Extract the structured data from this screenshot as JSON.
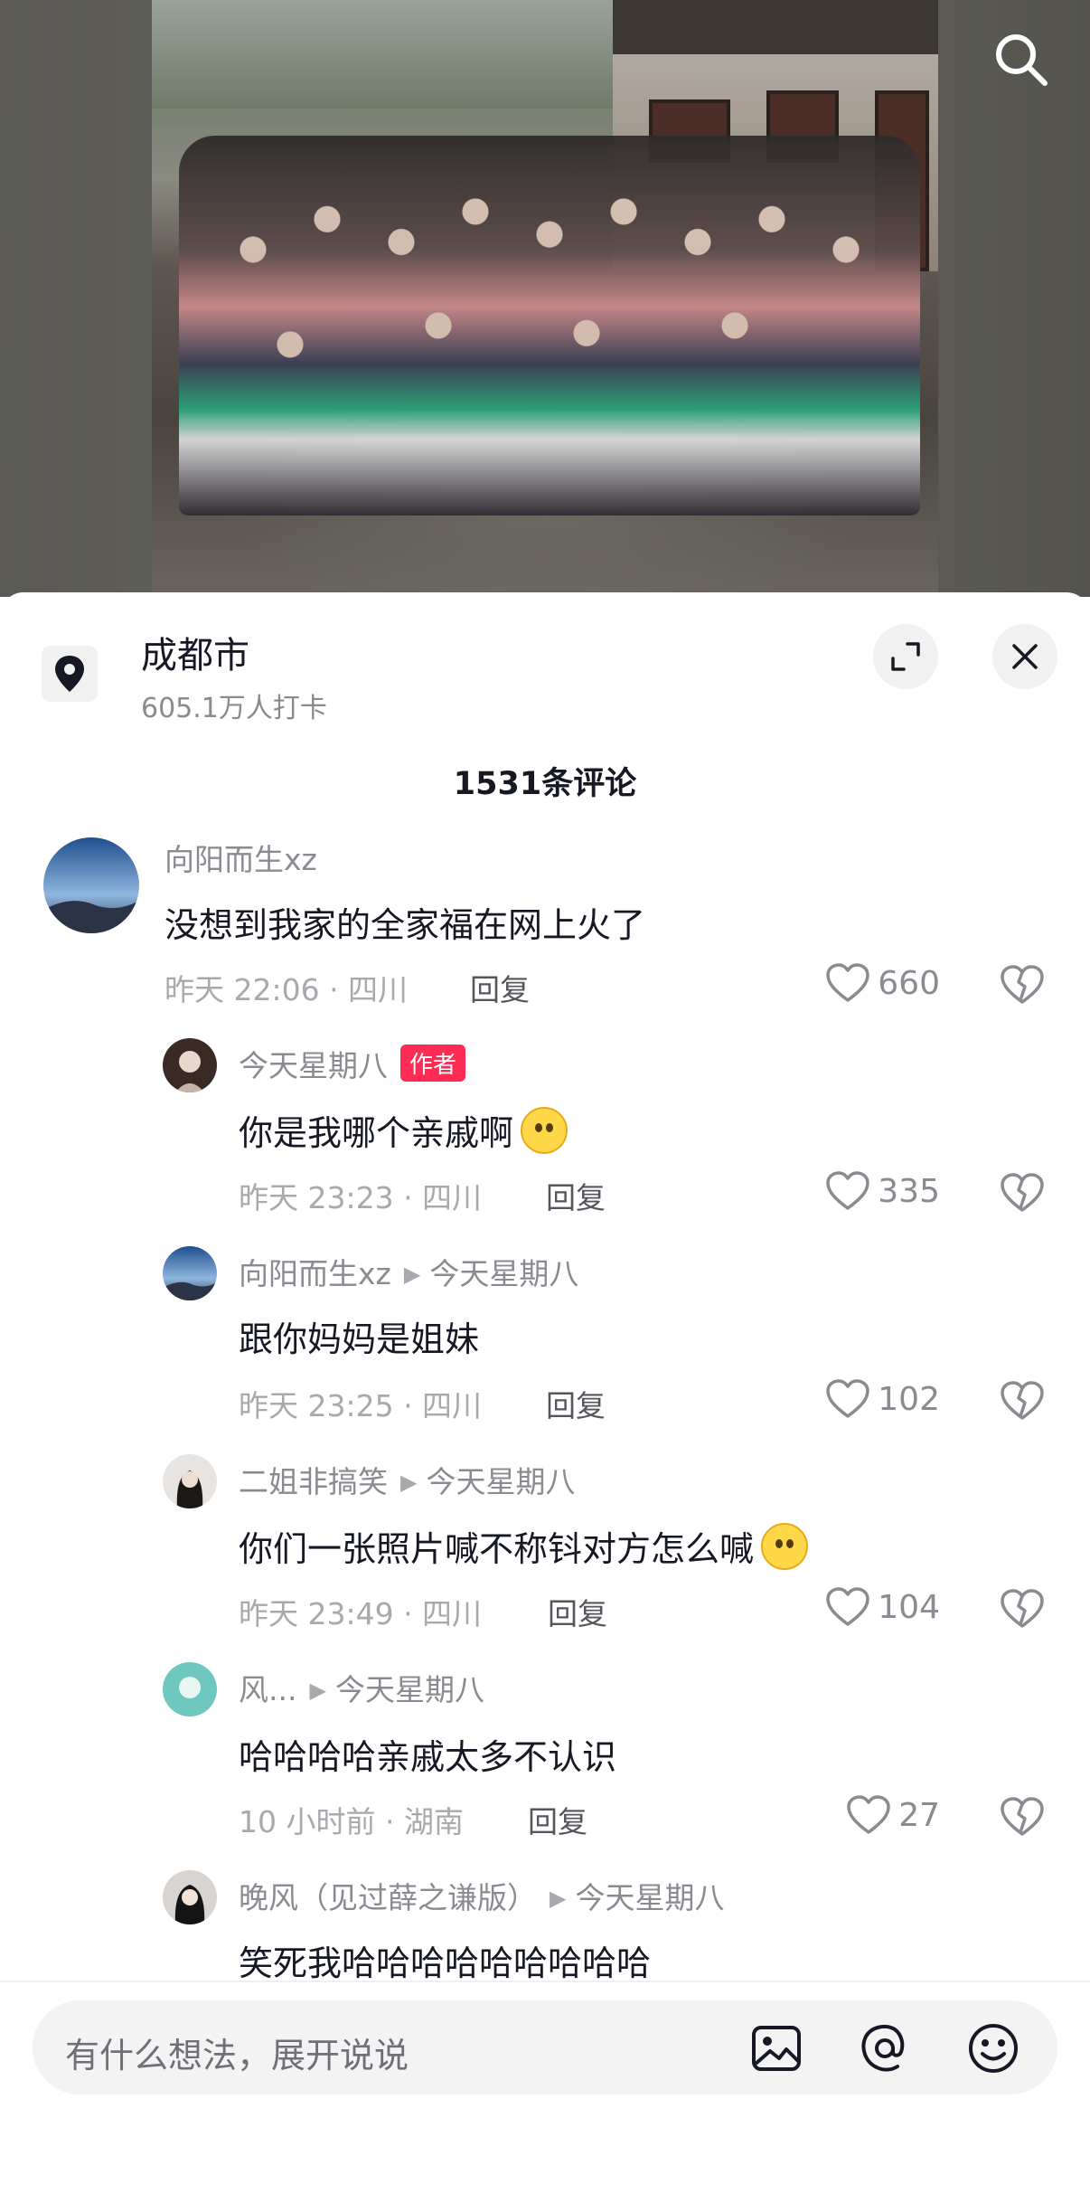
{
  "location": {
    "title": "成都市",
    "checkins": "605.1万人打卡"
  },
  "comment_count": "1531条评论",
  "comments": [
    {
      "user": "向阳而生xz",
      "text": "没想到我家的全家福在网上火了",
      "meta": "昨天 22:06 · 四川",
      "reply_label": "回复",
      "likes": "660"
    },
    {
      "user": "今天星期八",
      "author_tag": "作者",
      "text": "你是我哪个亲戚啊",
      "meta": "昨天 23:23 · 四川",
      "reply_label": "回复",
      "likes": "335"
    },
    {
      "user": "向阳而生xz",
      "reply_to": "今天星期八",
      "text": "跟你妈妈是姐妹",
      "meta": "昨天 23:25 · 四川",
      "reply_label": "回复",
      "likes": "102"
    },
    {
      "user": "二姐非搞笑",
      "reply_to": "今天星期八",
      "text": "你们一张照片喊不称钭对方怎么喊",
      "meta": "昨天 23:49 · 四川",
      "reply_label": "回复",
      "likes": "104"
    },
    {
      "user": "风...",
      "reply_to": "今天星期八",
      "text": "哈哈哈哈亲戚太多不认识",
      "meta": "10 小时前 · 湖南",
      "reply_label": "回复",
      "likes": "27"
    },
    {
      "user": "晚风（见过薛之谦版）",
      "reply_to": "今天星期八",
      "text": "笑死我哈哈哈哈哈哈哈哈哈"
    }
  ],
  "input": {
    "placeholder": "有什么想法，展开说说"
  },
  "icons": {
    "search": "search-icon",
    "location": "location-pin-icon",
    "expand": "expand-icon",
    "close": "close-icon",
    "like": "heart-icon",
    "dislike": "broken-heart-icon",
    "image": "image-icon",
    "mention": "at-icon",
    "emoji": "emoji-icon"
  },
  "colors": {
    "author_tag": "#fe2c55",
    "secondary_text": "#8a8b91"
  }
}
